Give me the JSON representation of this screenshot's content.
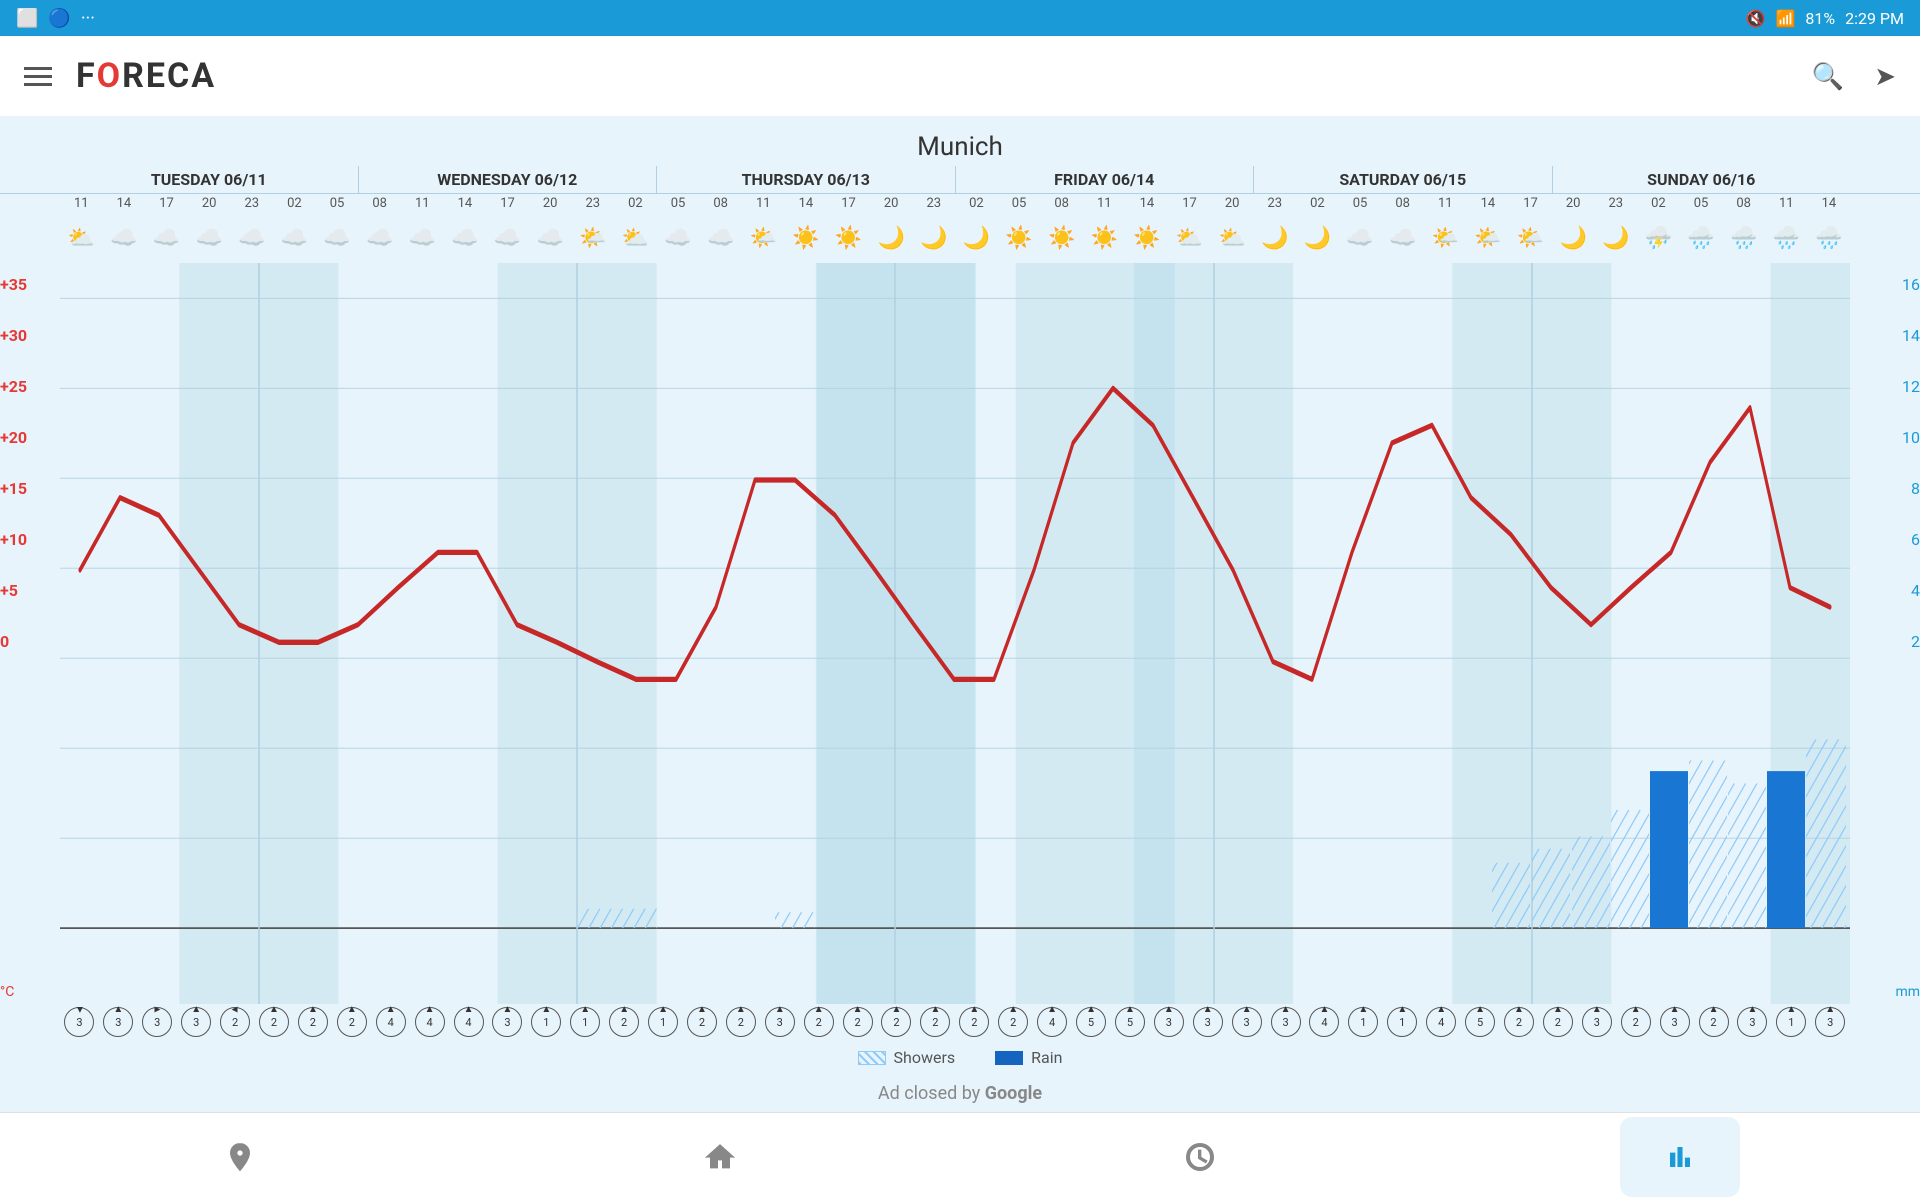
{
  "statusBar": {
    "time": "2:29 PM",
    "battery": "81%",
    "icons": [
      "notifications-muted-icon",
      "wifi-icon",
      "battery-icon"
    ]
  },
  "appBar": {
    "logo": "FORECA",
    "searchLabel": "Search",
    "locationLabel": "Location"
  },
  "city": "Munich",
  "days": [
    {
      "label": "TUESDAY 06/11",
      "hours": [
        "11",
        "14",
        "17",
        "20",
        "23"
      ]
    },
    {
      "label": "WEDNESDAY 06/12",
      "hours": [
        "02",
        "05",
        "08",
        "11",
        "14",
        "17",
        "20",
        "23"
      ]
    },
    {
      "label": "THURSDAY 06/13",
      "hours": [
        "02",
        "05",
        "08",
        "11",
        "14",
        "17",
        "20",
        "23"
      ]
    },
    {
      "label": "FRIDAY 06/14",
      "hours": [
        "02",
        "05",
        "08",
        "11",
        "14",
        "17",
        "20",
        "23"
      ]
    },
    {
      "label": "SATURDAY 06/15",
      "hours": [
        "02",
        "05",
        "08",
        "11",
        "14",
        "17",
        "20",
        "23"
      ]
    },
    {
      "label": "SUNDAY 06/16",
      "hours": [
        "02",
        "05",
        "08",
        "11",
        "14"
      ]
    }
  ],
  "yAxisLeft": [
    "+35",
    "+30",
    "+25",
    "+20",
    "+15",
    "+10",
    "+5",
    "0",
    "°C"
  ],
  "yAxisRight": [
    "16",
    "14",
    "12",
    "10",
    "8",
    "6",
    "4",
    "2",
    "mm"
  ],
  "legend": {
    "showers": "Showers",
    "rain": "Rain"
  },
  "adClosed": "Ad closed by Google",
  "bottomNav": [
    {
      "name": "location-nav",
      "label": ""
    },
    {
      "name": "home-nav",
      "label": ""
    },
    {
      "name": "clock-nav",
      "label": ""
    },
    {
      "name": "chart-nav",
      "label": "",
      "active": true
    }
  ]
}
